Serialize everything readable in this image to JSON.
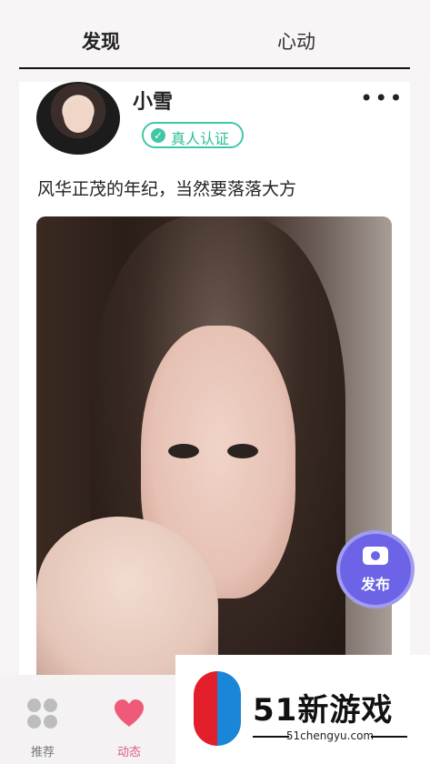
{
  "tabs": {
    "discover": "发现",
    "heartbeat": "心动"
  },
  "post": {
    "username": "小雪",
    "more_label": "•••",
    "badge": "真人认证",
    "caption": "风华正茂的年纪，当然要落落大方"
  },
  "fab": {
    "label": "发布"
  },
  "bottom_nav": {
    "home_label": "推荐",
    "feed_label": "动态"
  },
  "watermark": {
    "title": "51新游戏",
    "sub": "51chengyu.com"
  }
}
